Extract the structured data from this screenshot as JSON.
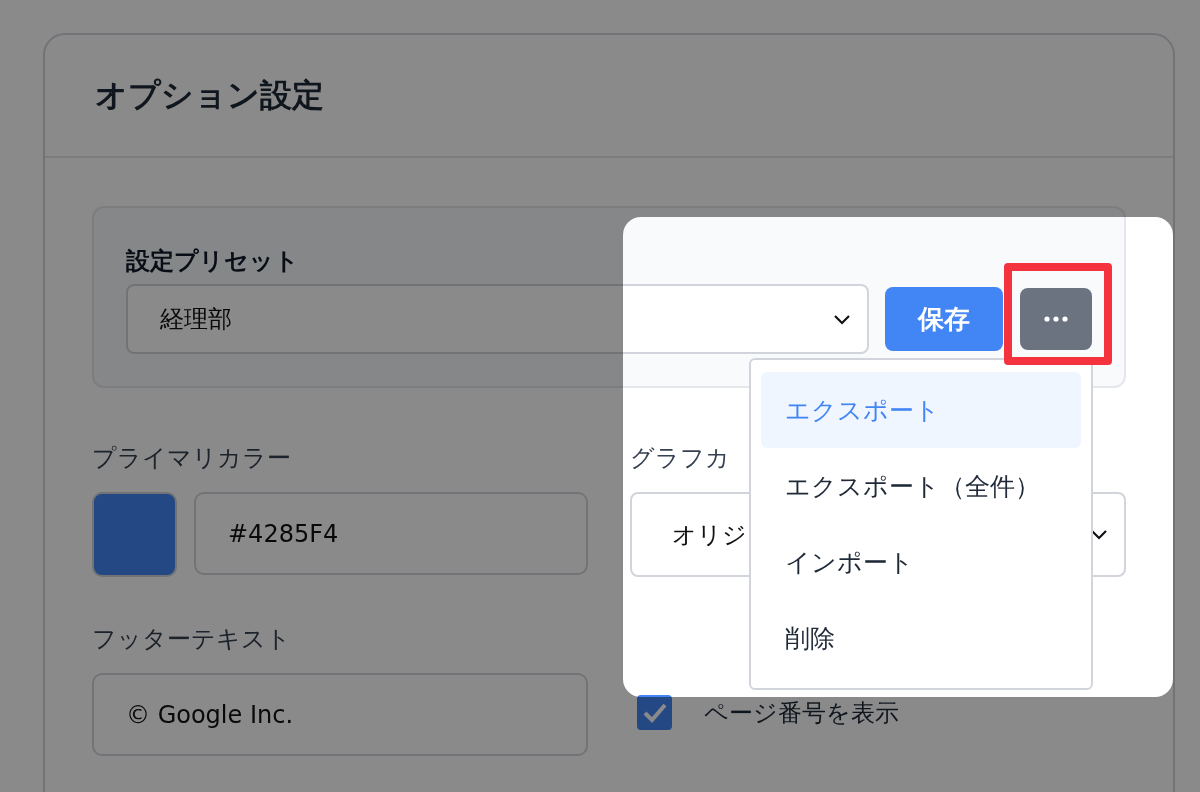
{
  "title": "オプション設定",
  "preset": {
    "label": "設定プリセット",
    "value": "経理部",
    "save_label": "保存"
  },
  "menu": [
    {
      "label": "エクスポート",
      "selected": true
    },
    {
      "label": "エクスポート（全件）",
      "selected": false
    },
    {
      "label": "インポート",
      "selected": false
    },
    {
      "label": "削除",
      "selected": false
    }
  ],
  "primary_color": {
    "label": "プライマリカラー",
    "value": "#4285F4"
  },
  "graph_color": {
    "label": "グラフカ",
    "value": "オリジ"
  },
  "footer_text": {
    "label": "フッターテキスト",
    "value": "© Google Inc."
  },
  "page_numbers": {
    "label": "ページ番号を表示",
    "checked": true
  }
}
